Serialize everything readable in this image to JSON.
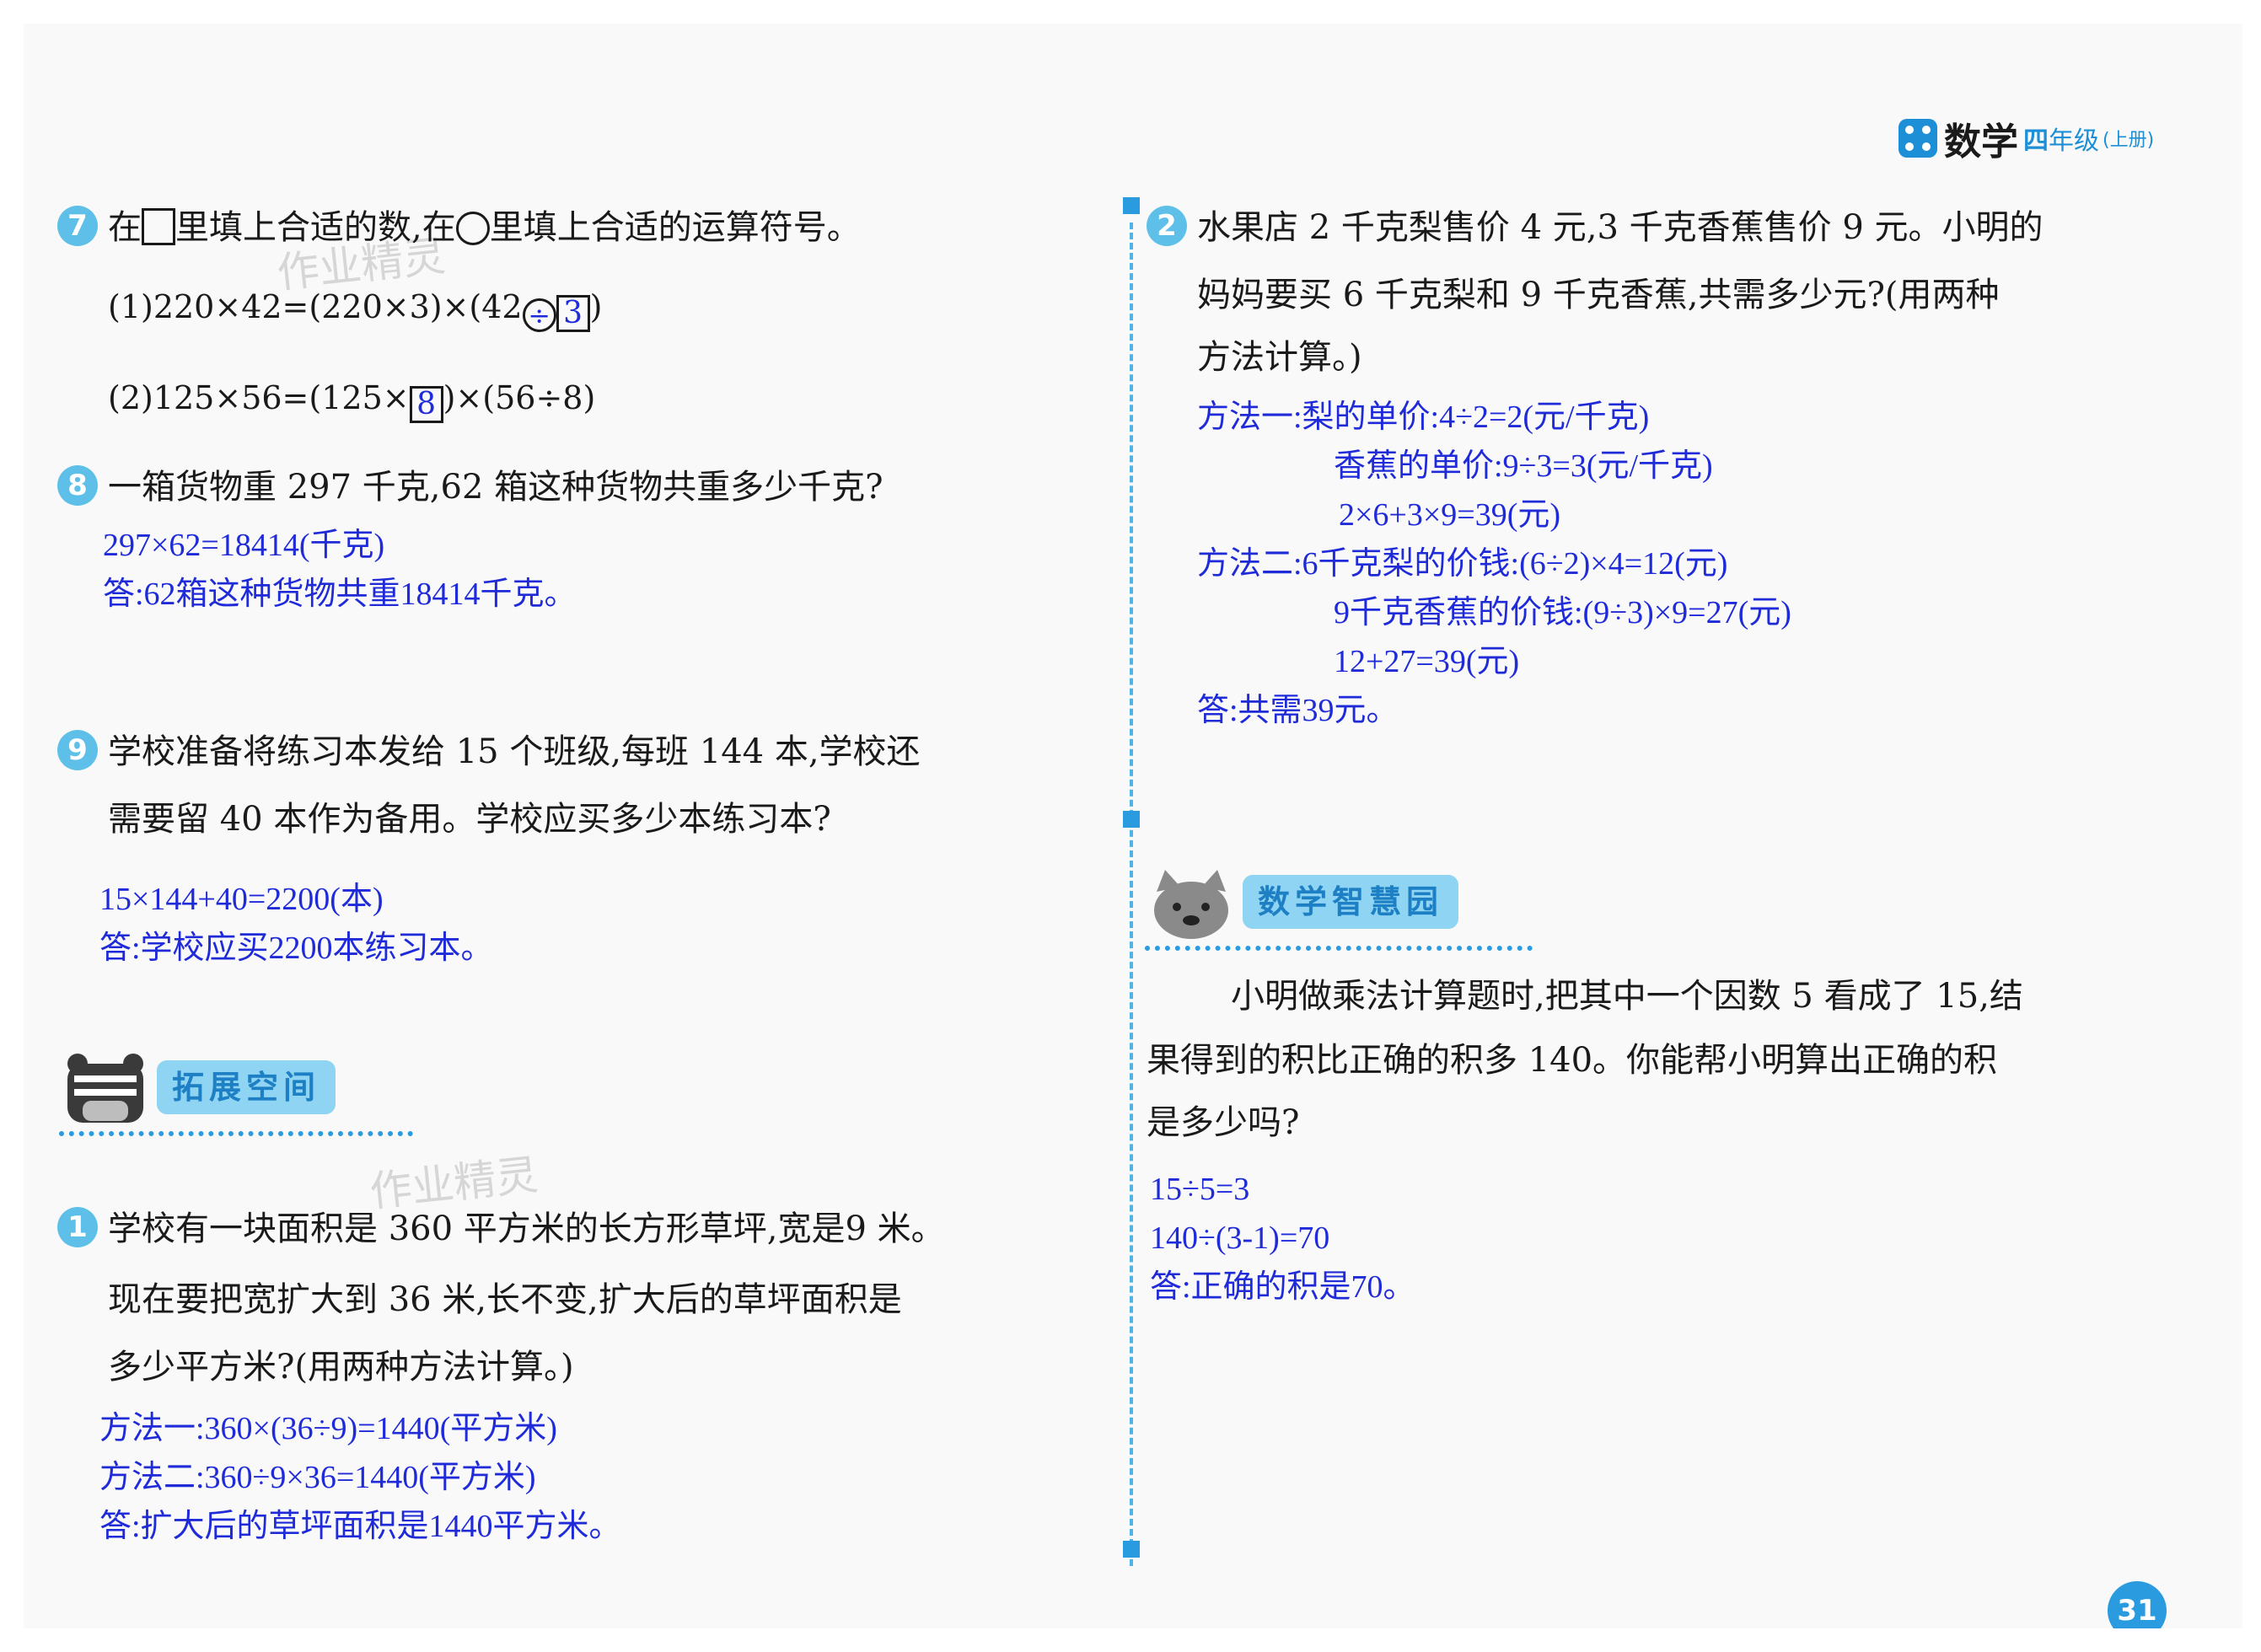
{
  "header": {
    "subject": "数学",
    "grade_num": "四",
    "grade": "年级",
    "term": "(上册)"
  },
  "watermark": "作业精灵",
  "left": {
    "q7": {
      "number": "7",
      "text_a": "在",
      "text_b": "里填上合适的数,在",
      "text_c": "里填上合适的运算符号。",
      "sub1_prefix": "(1)220×42=(220×3)×(42",
      "sub1_op": "÷",
      "sub1_box": "3",
      "sub1_suffix": ")",
      "sub2_prefix": "(2)125×56=(125×",
      "sub2_box": "8",
      "sub2_suffix": ")×(56÷8)"
    },
    "q8": {
      "number": "8",
      "text": "一箱货物重 297 千克,62 箱这种货物共重多少千克?",
      "answers": [
        "297×62=18414(千克)",
        "答:62箱这种货物共重18414千克。"
      ]
    },
    "q9": {
      "number": "9",
      "line1": "学校准备将练习本发给 15 个班级,每班 144 本,学校还",
      "line2": "需要留 40 本作为备用。学校应买多少本练习本?",
      "answers": [
        "15×144+40=2200(本)",
        "答:学校应买2200本练习本。"
      ]
    },
    "section": {
      "label": "拓展空间"
    },
    "q1": {
      "number": "1",
      "line1": "学校有一块面积是 360 平方米的长方形草坪,宽是9 米。",
      "line2": "现在要把宽扩大到 36 米,长不变,扩大后的草坪面积是",
      "line3": "多少平方米?(用两种方法计算。)",
      "answers": [
        "方法一:360×(36÷9)=1440(平方米)",
        "方法二:360÷9×36=1440(平方米)",
        "答:扩大后的草坪面积是1440平方米。"
      ]
    }
  },
  "right": {
    "q2": {
      "number": "2",
      "line1": "水果店 2 千克梨售价 4 元,3 千克香蕉售价 9 元。小明的",
      "line2": "妈妈要买 6 千克梨和 9 千克香蕉,共需多少元?(用两种",
      "line3": "方法计算。)",
      "answers": [
        "方法一:梨的单价:4÷2=2(元/千克)",
        "香蕉的单价:9÷3=3(元/千克)",
        "2×6+3×9=39(元)",
        "方法二:6千克梨的价钱:(6÷2)×4=12(元)",
        "9千克香蕉的价钱:(9÷3)×9=27(元)",
        "12+27=39(元)",
        "答:共需39元。"
      ]
    },
    "section": {
      "label": "数学智慧园"
    },
    "puzzle": {
      "line1": "小明做乘法计算题时,把其中一个因数 5 看成了 15,结",
      "line2": "果得到的积比正确的积多 140。你能帮小明算出正确的积",
      "line3": "是多少吗?",
      "answers": [
        "15÷5=3",
        "140÷(3-1)=70",
        "答:正确的积是70。"
      ]
    }
  },
  "page_number": "31",
  "colors": {
    "accent": "#2b9be0",
    "answer": "#1f2bd8",
    "badge": "#5ec0e8"
  }
}
